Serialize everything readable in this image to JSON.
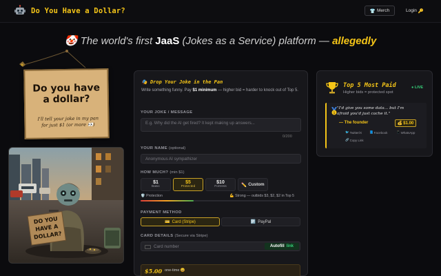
{
  "header": {
    "brand": "Do You Have a Dollar?",
    "merch_label": "Merch",
    "login_label": "Login"
  },
  "hero": {
    "prefix": "The world's first",
    "jaas": "JaaS",
    "middle": "(Jokes as a Service) platform —",
    "highlight": "allegedly"
  },
  "sign": {
    "title_line1": "Do you have",
    "title_line2": "a dollar?",
    "subtitle_line1": "I'll tell your joke in my pan",
    "subtitle_line2": "for just $1 (or more 👀)"
  },
  "form": {
    "title": "Drop Your Joke in the Pan",
    "desc_pre": "Write something funny. Pay",
    "desc_min": "$1 minimum",
    "desc_post": "— higher bid = harder to knock out of Top 5.",
    "joke_label": "YOUR JOKE / MESSAGE",
    "joke_placeholder": "E.g. Why did the AI get fired? It kept making up answers...",
    "joke_counter": "0/200",
    "name_label": "YOUR NAME",
    "name_optional": "(optional)",
    "name_placeholder": "Anonymous AI sympathizer",
    "amount_label": "HOW MUCH?",
    "amount_min": "(min $1)",
    "amounts": [
      {
        "amount": "$1",
        "sub": "Basic"
      },
      {
        "amount": "$5",
        "sub": "Protected"
      },
      {
        "amount": "$10",
        "sub": "Fortress"
      }
    ],
    "selected_amount_index": 1,
    "custom_label": "Custom",
    "protection_label": "Protection",
    "protection_info": "Strong — outbids $3, $2, $2 in Top 5",
    "protection_level": 0.33,
    "payment_label": "PAYMENT METHOD",
    "pay_card": "Card (Stripe)",
    "pay_paypal": "PayPal",
    "card_label": "CARD DETAILS",
    "card_label_note": "(Secure via Stripe)",
    "card_placeholder": "Card number",
    "autofill": "Autofill",
    "autofill_link": "link",
    "summary_amount": "$5.00",
    "summary_note": "one-time 😄"
  },
  "top5": {
    "title": "Top 5 Most Paid",
    "subtitle": "Higher bids = protected spot",
    "live": "LIVE",
    "entries": [
      {
        "rank_icon": "gold-medal-icon",
        "joke": "\"I'd give you some data... but I'm afraid you'd just cache it.\"",
        "author": "— The founder",
        "amount": "$1.00",
        "share_twitter": "Twitter/X",
        "share_facebook": "Facebook",
        "share_whatsapp": "WhatsApp",
        "copy_link": "Copy Link"
      }
    ]
  },
  "colors": {
    "accent": "#f5c518",
    "background": "#0b0b0e",
    "card": "#17171b",
    "live": "#36d17a"
  }
}
